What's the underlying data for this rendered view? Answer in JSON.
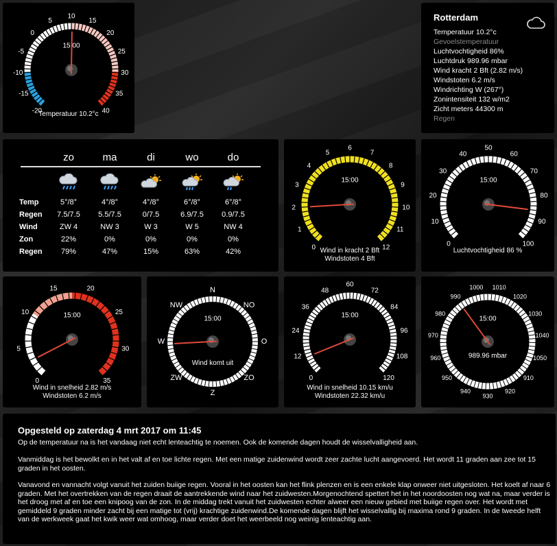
{
  "gauges": {
    "temp": {
      "scale_labels": [
        "-20",
        "-15",
        "-10",
        "-5",
        "0",
        "5",
        "10",
        "15",
        "20",
        "25",
        "30",
        "35",
        "40"
      ],
      "time": "15:00",
      "value": 10.2,
      "min": -20,
      "max": 40,
      "caption1": "Temperatuur 10.2°c"
    },
    "wind_bft": {
      "scale_labels": [
        "0",
        "1",
        "2",
        "3",
        "4",
        "5",
        "6",
        "7",
        "8",
        "9",
        "10",
        "11",
        "12"
      ],
      "time": "15:00",
      "value": 2,
      "min": 0,
      "max": 12,
      "caption1": "Wind in kracht  2 Bft",
      "caption2": "Windstoten 4 Bft"
    },
    "humidity": {
      "scale_labels": [
        "0",
        "10",
        "20",
        "30",
        "40",
        "50",
        "60",
        "70",
        "80",
        "90",
        "100"
      ],
      "time": "15:00",
      "value": 86,
      "min": 0,
      "max": 100,
      "caption1": "Luchtvochtigheid 86 %"
    },
    "wind_ms": {
      "scale_labels": [
        "0",
        "5",
        "10",
        "15",
        "20",
        "25",
        "30",
        "35"
      ],
      "time": "15:00",
      "value": 2.82,
      "min": 0,
      "max": 35,
      "caption1": "Wind in snelheid 2.82 m/s",
      "caption2": "Windstoten 6.2 m/s"
    },
    "compass": {
      "directions": [
        "N",
        "NO",
        "O",
        "ZO",
        "Z",
        "ZW",
        "W",
        "NW"
      ],
      "time": "15:00",
      "value_deg": 267,
      "caption1": "Wind komt uit"
    },
    "wind_kmh": {
      "scale_labels": [
        "0",
        "12",
        "24",
        "36",
        "48",
        "60",
        "72",
        "84",
        "96",
        "108",
        "120"
      ],
      "time": "15:00",
      "value": 10.15,
      "min": 0,
      "max": 120,
      "caption1": "Wind in snelheid 10.15 km/u",
      "caption2": "Windstoten 22.32 km/u"
    },
    "pressure": {
      "scale_labels": [
        "1010",
        "1020",
        "1030",
        "1040",
        "1050",
        "910",
        "920",
        "930",
        "940",
        "950",
        "960",
        "970",
        "980",
        "990",
        "1000"
      ],
      "time": "15:00",
      "value": 989.96,
      "caption1": "989.96 mbar"
    }
  },
  "info": {
    "city": "Rotterdam",
    "rows": [
      {
        "text": "Temperatuur 10.2°c",
        "dim": false
      },
      {
        "text": "Gevoelstemperatuur",
        "dim": true
      },
      {
        "text": "Luchtvochtigheid 86%",
        "dim": false
      },
      {
        "text": "Luchtdruk 989.96 mbar",
        "dim": false
      },
      {
        "text": "Wind kracht 2 Bft (2.82 m/s)",
        "dim": false
      },
      {
        "text": "Windstoten 6.2 m/s",
        "dim": false
      },
      {
        "text": "Windrichting W (267°)",
        "dim": false
      },
      {
        "text": "Zonintensiteit 132 w/m2",
        "dim": false
      },
      {
        "text": "Zicht meters 44300 m",
        "dim": false
      },
      {
        "text": "Regen",
        "dim": true
      }
    ],
    "icon": "cloud-icon"
  },
  "forecast": {
    "days": [
      "zo",
      "ma",
      "di",
      "wo",
      "do"
    ],
    "icons": [
      "rain-cloud-icon",
      "rain-cloud-icon",
      "sun-cloud-icon",
      "sun-cloud-rain-icon",
      "sun-cloud-rain-icon"
    ],
    "rows": [
      {
        "label": "Temp",
        "values": [
          "5°/8°",
          "4°/8°",
          "4°/8°",
          "6°/8°",
          "6°/8°"
        ]
      },
      {
        "label": "Regen",
        "values": [
          "7.5/7.5",
          "5.5/7.5",
          "0/7.5",
          "6.9/7.5",
          "0.9/7.5"
        ]
      },
      {
        "label": "Wind",
        "values": [
          "ZW 4",
          "NW 3",
          "W 3",
          "W 5",
          "NW 4"
        ]
      },
      {
        "label": "Zon",
        "values": [
          "22%",
          "0%",
          "0%",
          "0%",
          "0%"
        ]
      },
      {
        "label": "Regen",
        "values": [
          "79%",
          "47%",
          "15%",
          "63%",
          "42%"
        ]
      }
    ]
  },
  "report": {
    "title": "Opgesteld op zaterdag 4 mrt 2017 om 11:45",
    "paragraphs": [
      "Op de temperatuur na is het vandaag niet echt lenteachtig te noemen. Ook de komende dagen houdt de wisselvalligheid aan.",
      "Vanmiddag is het bewolkt en in het valt af en toe lichte regen. Met een matige zuidenwind wordt zeer zachte lucht aangevoerd. Het wordt 11 graden aan zee tot 15 graden in het oosten.",
      "Vanavond en vannacht volgt vanuit het zuiden buiige regen. Vooral in het oosten kan het flink plenzen en is een enkele klap onweer niet uitgesloten. Het koelt af naar 6 graden. Met het overtrekken van de regen draait de aantrekkende wind naar het zuidwesten.Morgenochtend spettert het in het noordoosten nog wat na, maar verder is het droog met af en toe een knipoog van de zon. In de middag trekt vanuit het zuidwesten echter alweer een nieuw gebied met buiige regen over. Het wordt met gemiddeld 9 graden minder zacht bij een matige tot (vrij) krachtige zuidenwind.De komende dagen blijft het wisselvallig bij maxima rond 9 graden. In de tweede helft van de werkweek gaat het kwik weer wat omhoog, maar verder doet het weerbeeld nog weinig lenteachtig aan."
    ]
  },
  "colors": {
    "needle": "#e04a3a",
    "arc_white": "#ffffff",
    "arc_blue": "#2aa3e0",
    "arc_red": "#e0321e",
    "arc_yellow": "#f0e020"
  }
}
